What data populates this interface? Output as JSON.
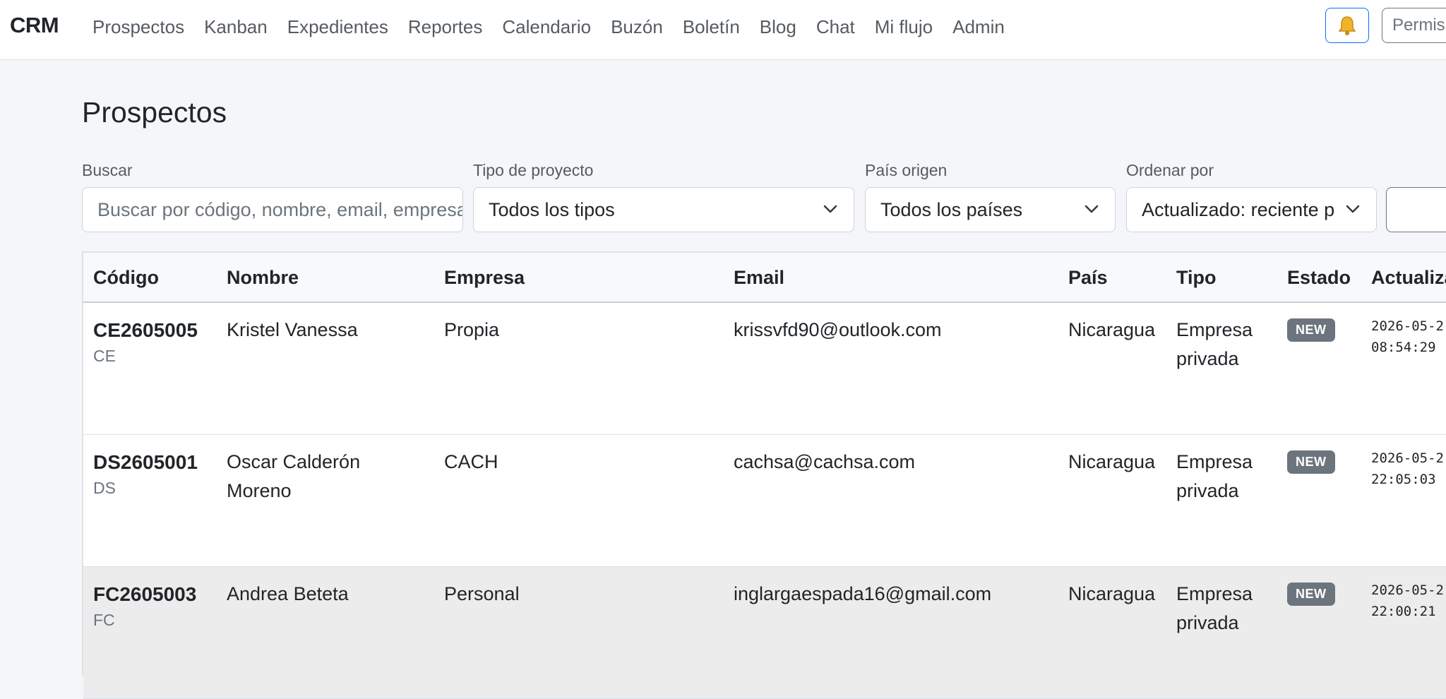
{
  "navbar": {
    "brand": "CRM",
    "links": [
      "Prospectos",
      "Kanban",
      "Expedientes",
      "Reportes",
      "Calendario",
      "Buzón",
      "Boletín",
      "Blog",
      "Chat",
      "Mi flujo",
      "Admin"
    ],
    "bell_icon": "bell-icon",
    "permissions_label": "Permis"
  },
  "page": {
    "title": "Prospectos"
  },
  "filters": {
    "search": {
      "label": "Buscar",
      "placeholder": "Buscar por código, nombre, email, empresa"
    },
    "project_type": {
      "label": "Tipo de proyecto",
      "value": "Todos los tipos"
    },
    "country": {
      "label": "País origen",
      "value": "Todos los países"
    },
    "order": {
      "label": "Ordenar por",
      "value": "Actualizado: reciente primero"
    }
  },
  "table": {
    "columns": [
      "Código",
      "Nombre",
      "Empresa",
      "Email",
      "País",
      "Tipo",
      "Estado",
      "Actualiza"
    ],
    "rows": [
      {
        "code": "CE2605005",
        "prefix": "CE",
        "name": "Kristel Vanessa",
        "company": "Propia",
        "email": "krissvfd90@outlook.com",
        "country": "Nicaragua",
        "type": "Empresa privada",
        "status": "NEW",
        "updated_date": "2026-05-2",
        "updated_time": "08:54:29"
      },
      {
        "code": "DS2605001",
        "prefix": "DS",
        "name": "Oscar Calderón Moreno",
        "company": "CACH",
        "email": "cachsa@cachsa.com",
        "country": "Nicaragua",
        "type": "Empresa privada",
        "status": "NEW",
        "updated_date": "2026-05-2",
        "updated_time": "22:05:03"
      },
      {
        "code": "FC2605003",
        "prefix": "FC",
        "name": "Andrea Beteta",
        "company": "Personal",
        "email": "inglargaespada16@gmail.com",
        "country": "Nicaragua",
        "type": "Empresa privada",
        "status": "NEW",
        "updated_date": "2026-05-2",
        "updated_time": "22:00:21"
      }
    ]
  },
  "colors": {
    "accent": "#0d6efd",
    "badge": "#6c757d",
    "background": "#f5f6fa"
  }
}
